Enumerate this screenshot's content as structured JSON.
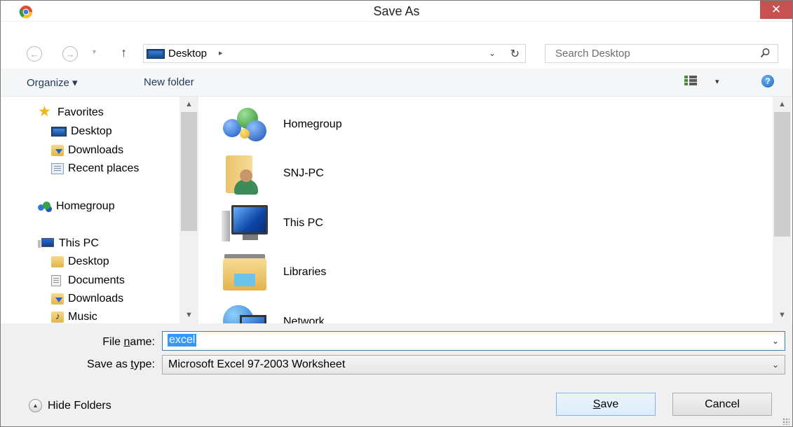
{
  "window": {
    "title": "Save As",
    "close_glyph": "✕"
  },
  "address": {
    "back_glyph": "←",
    "forward_glyph": "→",
    "up_glyph": "↑",
    "location": "Desktop",
    "separator_glyph": "▸",
    "dropdown_glyph": "⌄",
    "refresh_glyph": "↻"
  },
  "search": {
    "placeholder": "Search Desktop",
    "icon": "search-icon"
  },
  "toolbar": {
    "organize_label": "Organize ▾",
    "new_folder_label": "New folder",
    "view_dd": "▾",
    "help_glyph": "?"
  },
  "sidebar": {
    "items": [
      {
        "label": "Favorites",
        "icon": "star-icon"
      },
      {
        "label": "Desktop",
        "icon": "desktop-icon"
      },
      {
        "label": "Downloads",
        "icon": "downloads-folder-icon"
      },
      {
        "label": "Recent places",
        "icon": "recent-places-icon"
      },
      {
        "label": "Homegroup",
        "icon": "homegroup-icon"
      },
      {
        "label": "This PC",
        "icon": "computer-icon"
      },
      {
        "label": "Desktop",
        "icon": "desktop-folder-icon"
      },
      {
        "label": "Documents",
        "icon": "documents-icon"
      },
      {
        "label": "Downloads",
        "icon": "downloads-folder-icon"
      },
      {
        "label": "Music",
        "icon": "music-folder-icon"
      }
    ]
  },
  "content": {
    "items": [
      {
        "label": "Homegroup",
        "icon": "homegroup-icon"
      },
      {
        "label": "SNJ-PC",
        "icon": "user-folder-icon"
      },
      {
        "label": "This PC",
        "icon": "computer-icon"
      },
      {
        "label": "Libraries",
        "icon": "libraries-icon"
      },
      {
        "label": "Network",
        "icon": "network-icon"
      }
    ]
  },
  "form": {
    "file_name_label_pre": "File ",
    "file_name_label_u": "n",
    "file_name_label_post": "ame:",
    "file_name_value": "excel",
    "save_type_label_pre": "Save as ",
    "save_type_label_u": "t",
    "save_type_label_post": "ype:",
    "save_type_value": "Microsoft Excel 97-2003 Worksheet",
    "dropdown_glyph": "⌄"
  },
  "footer": {
    "hide_folders_label": "Hide Folders",
    "save_pre": "",
    "save_u": "S",
    "save_post": "ave",
    "cancel_label": "Cancel"
  },
  "scroll": {
    "up_glyph": "▲",
    "down_glyph": "▼"
  },
  "colors": {
    "accent": "#3399ff",
    "close": "#c75050",
    "selection": "#3399ff"
  }
}
